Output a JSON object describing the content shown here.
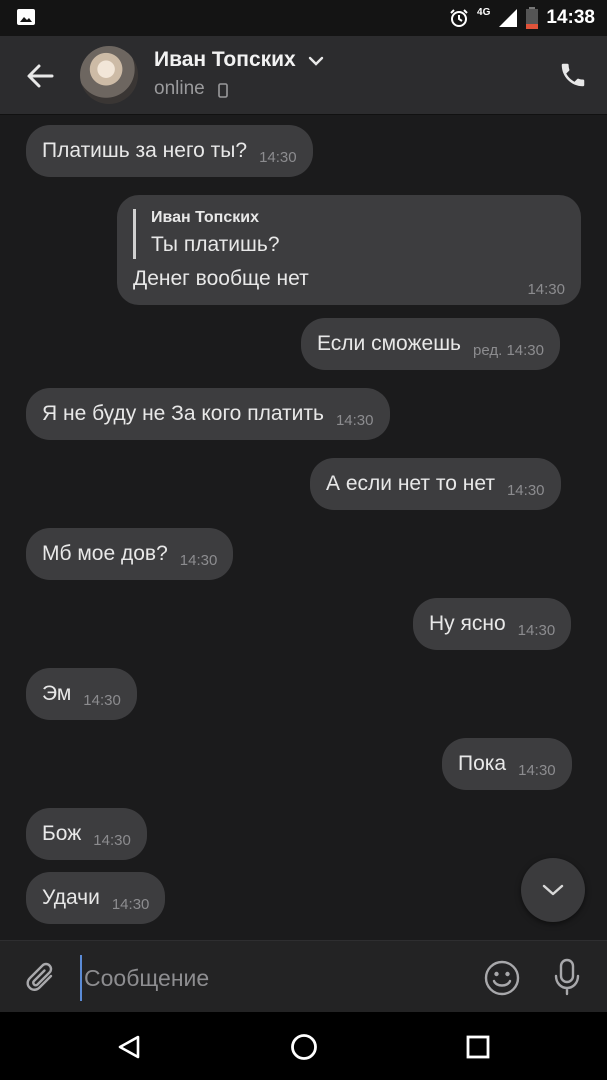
{
  "status_bar": {
    "time": "14:38",
    "network": "4G"
  },
  "header": {
    "contact_name": "Иван Топских",
    "status": "online"
  },
  "messages": [
    {
      "id": 0,
      "side": "incoming",
      "text": "Платишь за него ты?",
      "time": "14:30"
    },
    {
      "id": 1,
      "side": "outgoing",
      "reply_author": "Иван Топских",
      "reply_text": "Ты платишь?",
      "text": "Денег вообще нет",
      "time": "14:30"
    },
    {
      "id": 2,
      "side": "outgoing",
      "text": "Если сможешь",
      "edited": "ред.",
      "time": "14:30"
    },
    {
      "id": 3,
      "side": "incoming",
      "text": "Я не буду не За кого платить",
      "time": "14:30"
    },
    {
      "id": 4,
      "side": "outgoing",
      "text": "А если нет то нет",
      "time": "14:30"
    },
    {
      "id": 5,
      "side": "incoming",
      "text": "Мб мое дов?",
      "time": "14:30"
    },
    {
      "id": 6,
      "side": "outgoing",
      "text": "Ну ясно",
      "time": "14:30"
    },
    {
      "id": 7,
      "side": "incoming",
      "text": "Эм",
      "time": "14:30"
    },
    {
      "id": 8,
      "side": "outgoing",
      "text": "Пока",
      "time": "14:30"
    },
    {
      "id": 9,
      "side": "incoming",
      "text": "Бож",
      "time": "14:30"
    },
    {
      "id": 10,
      "side": "incoming",
      "text": "Удачи",
      "time": "14:30"
    }
  ],
  "composer": {
    "placeholder": "Сообщение"
  },
  "colors": {
    "background": "#1b1b1c",
    "bubble": "#3d3d3f",
    "header": "#2c2c2e",
    "accent": "#5b8bd6"
  },
  "icons": [
    "image-icon",
    "alarm-icon",
    "signal-icon",
    "battery-icon",
    "back-arrow-icon",
    "chevron-down-icon",
    "mobile-phone-icon",
    "phone-icon",
    "attach-icon",
    "emoji-icon",
    "microphone-icon",
    "nav-back-icon",
    "nav-home-icon",
    "nav-recent-icon"
  ]
}
